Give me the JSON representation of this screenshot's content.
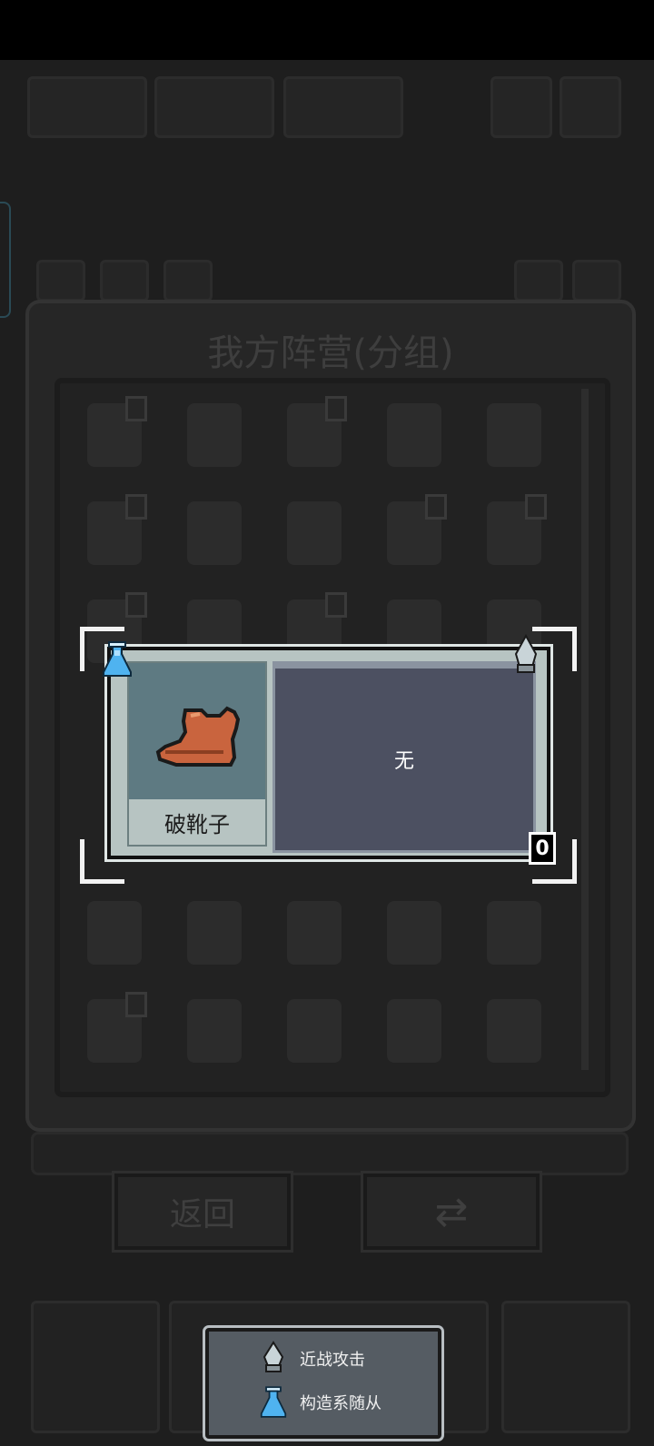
{
  "panel": {
    "title": "我方阵营(分组)"
  },
  "buttons": {
    "back_label": "返回"
  },
  "popup": {
    "item_name": "破靴子",
    "description": "无",
    "level": "0",
    "left_icon": "flask-icon",
    "right_icon": "spearhead-icon"
  },
  "tooltip": {
    "rows": [
      {
        "icon": "spearhead-icon",
        "label": "近战攻击"
      },
      {
        "icon": "flask-icon",
        "label": "构造系随从"
      }
    ]
  },
  "colors": {
    "popup_bg": "#b7c4c2",
    "desc_bg": "#4c5061",
    "item_art_bg": "#5e7a82",
    "boot_color": "#c9643e",
    "flask_color": "#4fb3f0"
  }
}
